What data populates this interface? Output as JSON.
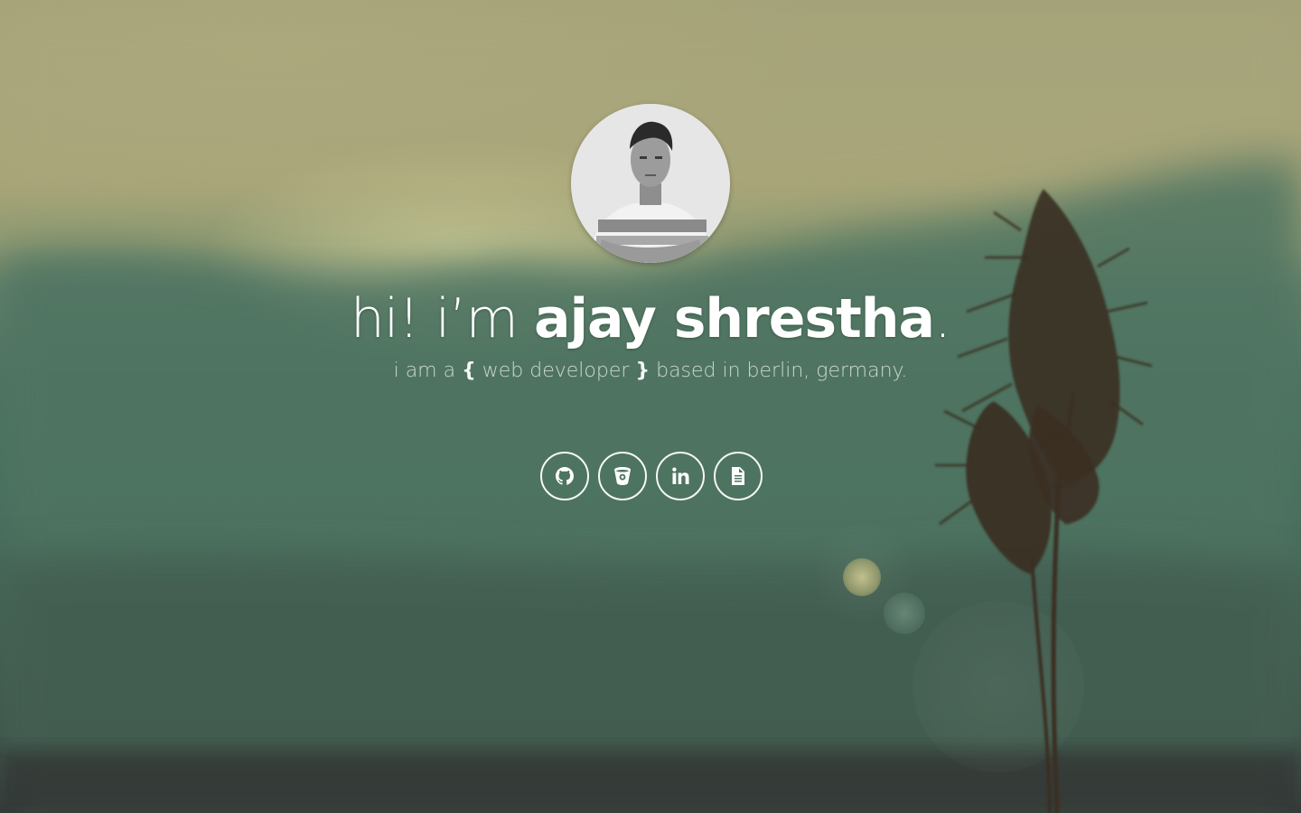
{
  "hero": {
    "greeting": "hi! i’m",
    "name": "ajay shrestha",
    "period": ".",
    "tagline_pre": "i am a",
    "tagline_brace_open": "{",
    "tagline_role": "web developer",
    "tagline_brace_close": "}",
    "tagline_post": "based in berlin, germany."
  },
  "avatar": {
    "alt": "ajay shrestha profile photo"
  },
  "social": [
    {
      "icon": "github-icon"
    },
    {
      "icon": "bitbucket-icon"
    },
    {
      "icon": "linkedin-icon"
    },
    {
      "icon": "document-icon"
    }
  ],
  "colors": {
    "text": "#ffffff",
    "sky": "#a6a47a",
    "hills": "#486e5d"
  }
}
